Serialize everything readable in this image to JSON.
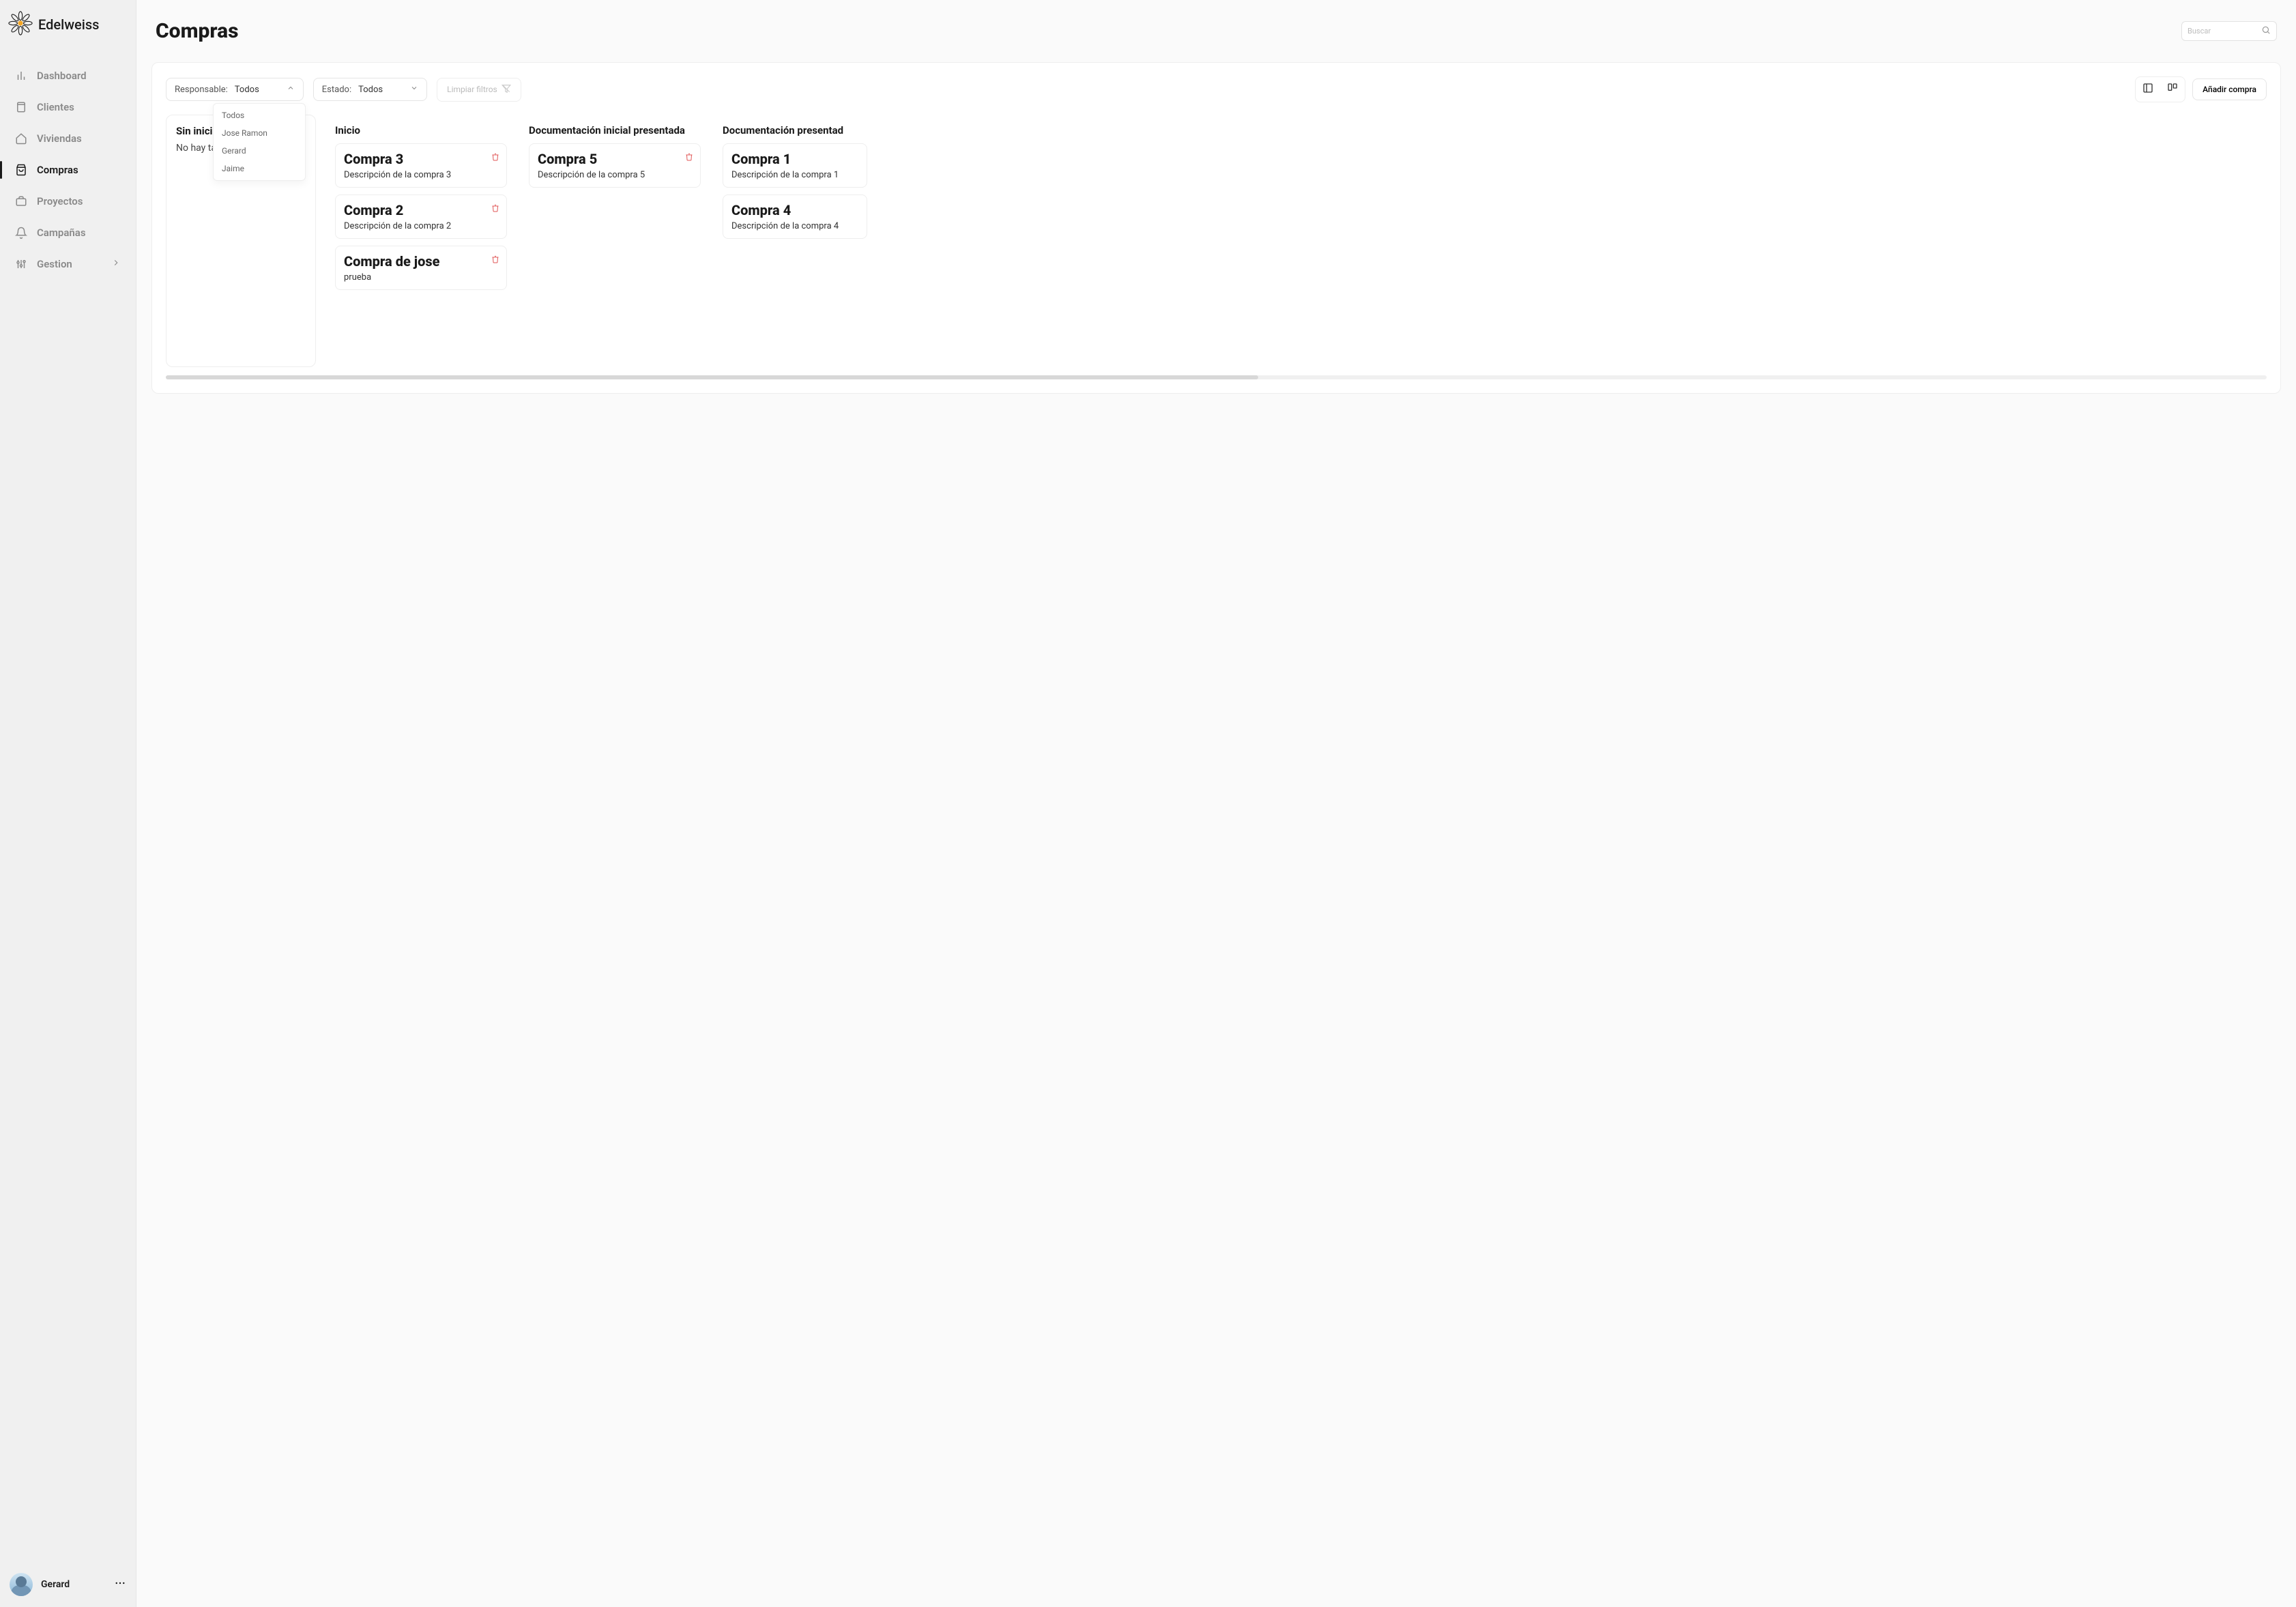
{
  "brand": "Edelweiss",
  "sidebar": {
    "items": [
      {
        "label": "Dashboard",
        "icon": "bar-chart"
      },
      {
        "label": "Clientes",
        "icon": "book"
      },
      {
        "label": "Viviendas",
        "icon": "home"
      },
      {
        "label": "Compras",
        "icon": "shopping-bag",
        "active": true
      },
      {
        "label": "Proyectos",
        "icon": "briefcase"
      },
      {
        "label": "Campañas",
        "icon": "bell"
      },
      {
        "label": "Gestion",
        "icon": "sliders",
        "expandable": true
      }
    ]
  },
  "user": {
    "name": "Gerard"
  },
  "page": {
    "title": "Compras",
    "search_placeholder": "Buscar"
  },
  "filters": {
    "responsable": {
      "label": "Responsable:",
      "value": "Todos",
      "options": [
        "Todos",
        "Jose Ramon",
        "Gerard",
        "Jaime"
      ]
    },
    "estado": {
      "label": "Estado:",
      "value": "Todos"
    },
    "clear_label": "Limpiar filtros",
    "add_label": "Añadir compra"
  },
  "board": {
    "columns": [
      {
        "title": "Sin inicia",
        "empty_text": "No hay tar",
        "cards": []
      },
      {
        "title": "Inicio",
        "cards": [
          {
            "title": "Compra 3",
            "desc": "Descripción de la compra 3",
            "deletable": true
          },
          {
            "title": "Compra 2",
            "desc": "Descripción de la compra 2",
            "deletable": true
          },
          {
            "title": "Compra de jose",
            "desc": "prueba",
            "deletable": true
          }
        ]
      },
      {
        "title": "Documentación inicial presentada",
        "cards": [
          {
            "title": "Compra 5",
            "desc": "Descripción de la compra 5",
            "deletable": true
          }
        ]
      },
      {
        "title": "Documentación presentad",
        "cards": [
          {
            "title": "Compra 1",
            "desc": "Descripción de la compra 1",
            "deletable": false
          },
          {
            "title": "Compra 4",
            "desc": "Descripción de la compra 4",
            "deletable": false
          }
        ]
      }
    ]
  }
}
